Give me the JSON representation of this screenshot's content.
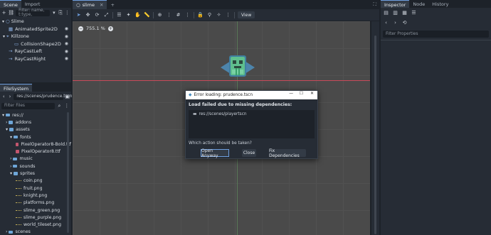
{
  "scene_dock": {
    "tabs": [
      "Scene",
      "Import"
    ],
    "filter_placeholder": "Filter: name, t:type,",
    "nodes": [
      {
        "label": "Slime",
        "icon": "node2d-icon"
      },
      {
        "label": "AnimatedSprite2D",
        "icon": "animated-sprite-icon"
      },
      {
        "label": "Killzone",
        "icon": "area2d-icon"
      },
      {
        "label": "CollisionShape2D",
        "icon": "collision-shape-icon"
      },
      {
        "label": "RayCastLeft",
        "icon": "raycast-icon"
      },
      {
        "label": "RayCastRight",
        "icon": "raycast-icon"
      }
    ]
  },
  "filesystem": {
    "tab": "FileSystem",
    "path": "res://scenes/prudence.tscn",
    "filter_placeholder": "Filter Files",
    "items": [
      {
        "label": "res://",
        "type": "folder"
      },
      {
        "label": "addons",
        "type": "folder"
      },
      {
        "label": "assets",
        "type": "folder"
      },
      {
        "label": "fonts",
        "type": "folder"
      },
      {
        "label": "PixelOperator8-Bold.ttf",
        "type": "ttf"
      },
      {
        "label": "PixelOperator8.ttf",
        "type": "ttf"
      },
      {
        "label": "music",
        "type": "folder"
      },
      {
        "label": "sounds",
        "type": "folder"
      },
      {
        "label": "sprites",
        "type": "folder"
      },
      {
        "label": "coin.png",
        "type": "png"
      },
      {
        "label": "fruit.png",
        "type": "png"
      },
      {
        "label": "knight.png",
        "type": "png"
      },
      {
        "label": "platforms.png",
        "type": "png"
      },
      {
        "label": "slime_green.png",
        "type": "png"
      },
      {
        "label": "slime_purple.png",
        "type": "png"
      },
      {
        "label": "world_tileset.png",
        "type": "png"
      },
      {
        "label": "scenes",
        "type": "folder"
      }
    ]
  },
  "editor": {
    "scene_tab": "slime",
    "add_tab": "+",
    "view_button": "View",
    "zoom": "755.1 %"
  },
  "dialog": {
    "title": "Error loading: prudence.tscn",
    "message": "Load failed due to missing dependencies:",
    "missing": "res://scenes/playertscn",
    "question": "Which action should be taken?",
    "btn_open": "Open Anyway",
    "btn_close": "Close",
    "btn_fix": "Fix Dependencies"
  },
  "inspector": {
    "tabs": [
      "Inspector",
      "Node",
      "History"
    ],
    "filter_placeholder": "Filter Properties"
  },
  "colors": {
    "accent": "#6e9fe0",
    "panel": "#262c35",
    "viewport": "#4a4a4a",
    "guide_red": "#c84a5a"
  }
}
